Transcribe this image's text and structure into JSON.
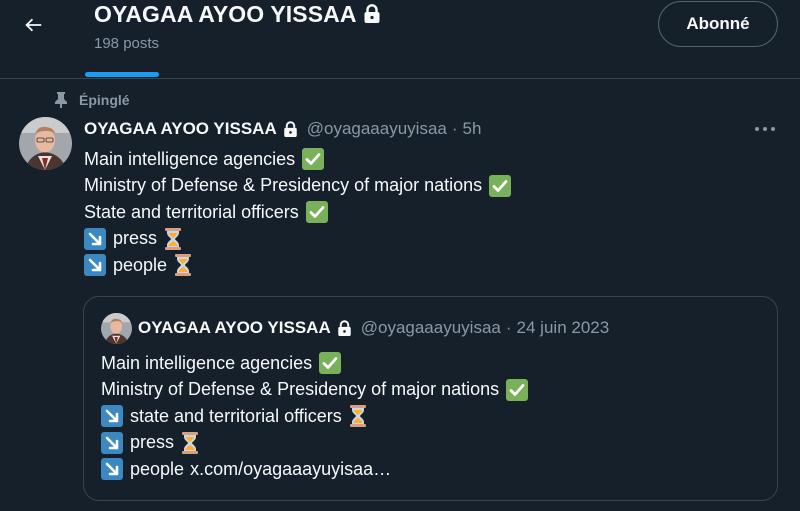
{
  "header": {
    "profile_name": "OYAGAA AYOO YISSAA",
    "post_count": "198 posts",
    "follow_label": "Abonné"
  },
  "pinned": {
    "label": "Épinglé"
  },
  "tweet": {
    "author": "OYAGAA AYOO YISSAA",
    "handle": "@oyagaaayuyisaa",
    "separator": "·",
    "time": "5h",
    "lines": [
      {
        "text": "Main intelligence agencies",
        "emoji": "check-mark-icon"
      },
      {
        "text": "Ministry of Defense & Presidency of major nations",
        "emoji": "check-mark-icon"
      },
      {
        "text": "State and territorial officers",
        "emoji": "check-mark-icon"
      },
      {
        "text": "press",
        "emoji": "hourglass-icon",
        "prefix": "arrow-down-right-icon"
      },
      {
        "text": "people",
        "emoji": "hourglass-icon",
        "prefix": "arrow-down-right-icon"
      }
    ]
  },
  "quote": {
    "author": "OYAGAA AYOO YISSAA",
    "handle": "@oyagaaayuyisaa",
    "separator": "·",
    "date": "24 juin 2023",
    "lines": [
      {
        "text": "Main intelligence agencies",
        "emoji": "check-mark-icon"
      },
      {
        "text": "Ministry of Defense & Presidency of major nations",
        "emoji": "check-mark-icon"
      },
      {
        "text": "state and territorial officers",
        "emoji": "hourglass-icon",
        "prefix": "arrow-down-right-icon"
      },
      {
        "text": "press",
        "emoji": "hourglass-icon",
        "prefix": "arrow-down-right-icon"
      },
      {
        "text": "people",
        "prefix": "arrow-down-right-icon",
        "link": "x.com/oyagaaayuyisaa…"
      }
    ]
  },
  "colors": {
    "background": "#15202b",
    "accent": "#1d9bf0",
    "secondary_text": "#8b98a5",
    "border": "#38444d",
    "check_green": "#78b159",
    "arrow_blue": "#3b88c3"
  }
}
